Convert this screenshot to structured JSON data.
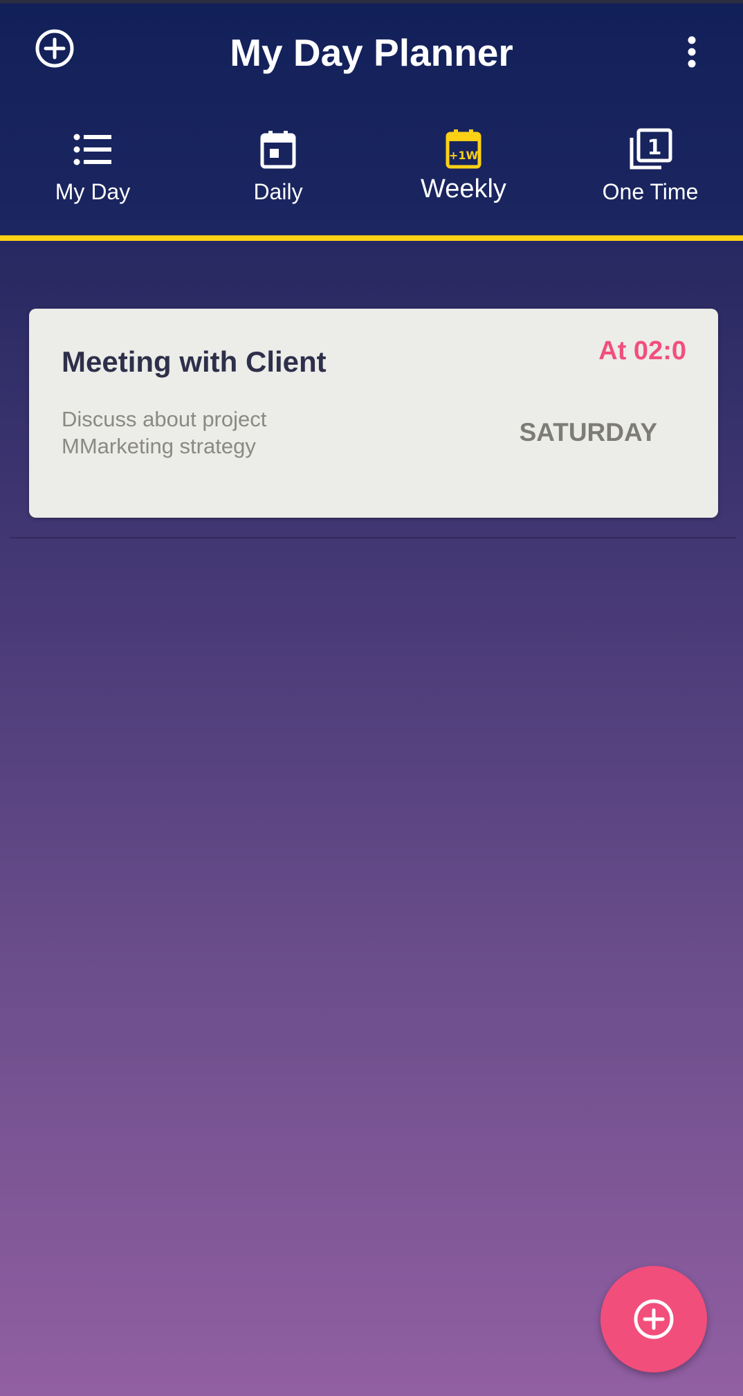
{
  "app": {
    "title": "My Day Planner",
    "add_icon": "add-circle-icon",
    "menu_icon": "more-vertical-icon"
  },
  "tabs": [
    {
      "label": "My Day",
      "icon": "list-icon",
      "active": false
    },
    {
      "label": "Daily",
      "icon": "calendar-day-icon",
      "active": false
    },
    {
      "label": "Weekly",
      "icon": "calendar-week-icon",
      "icon_text": "+1W",
      "active": true
    },
    {
      "label": "One Time",
      "icon": "one-time-icon",
      "icon_text": "1",
      "active": false
    }
  ],
  "tasks": [
    {
      "title": "Meeting with Client",
      "time": "At 02:0",
      "description": "Discuss about project MMarketing strategy",
      "day": "SATURDAY"
    }
  ],
  "fab": {
    "icon": "add-circle-icon"
  },
  "colors": {
    "header": "#12205a",
    "accent_active_tab": "#fcd116",
    "time_text": "#f14f7c",
    "fab": "#f24e7b",
    "card": "#ecece8"
  }
}
